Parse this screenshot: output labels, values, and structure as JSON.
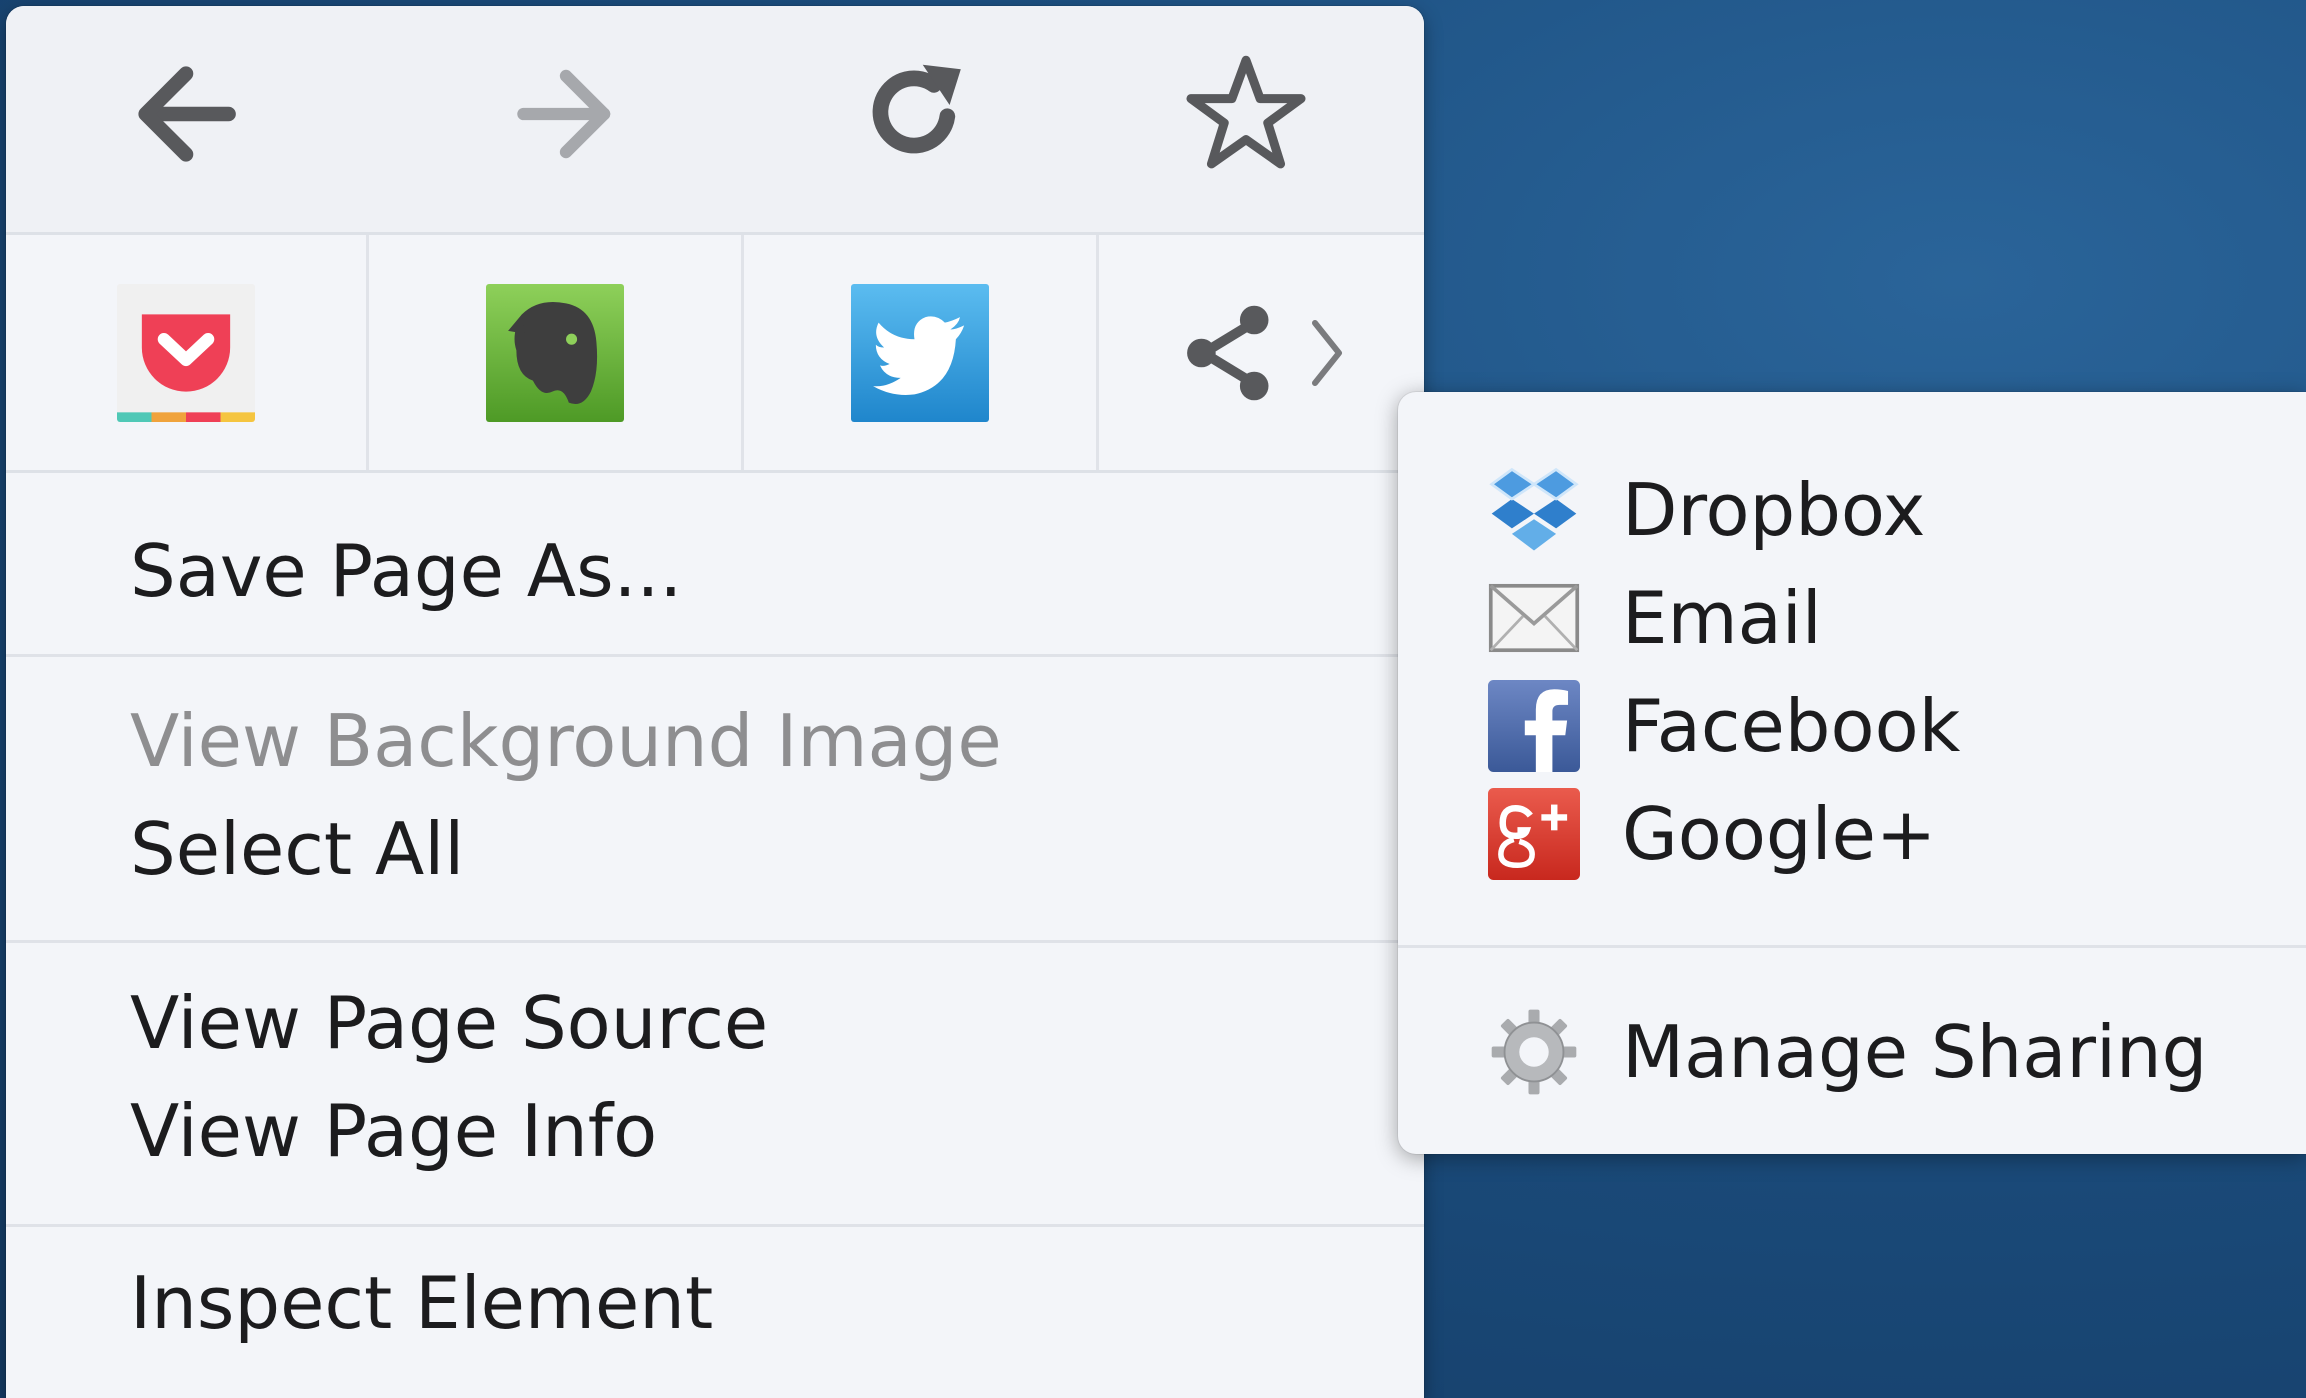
{
  "navigation": {
    "back_icon": "arrow-left-icon",
    "forward_icon": "arrow-right-icon",
    "reload_icon": "reload-icon",
    "bookmark_icon": "star-icon"
  },
  "share_toolbar": {
    "items": [
      {
        "name": "Pocket",
        "icon": "pocket-icon",
        "color": "#ef4056"
      },
      {
        "name": "Evernote",
        "icon": "evernote-icon",
        "color": "#6fb536"
      },
      {
        "name": "Twitter",
        "icon": "twitter-icon",
        "color": "#2f9be0"
      },
      {
        "name": "Share",
        "icon": "share-icon",
        "submenu_icon": "chevron-right-icon"
      }
    ]
  },
  "menu": {
    "save_page_as": "Save Page As...",
    "view_background_image": "View Background Image",
    "select_all": "Select All",
    "view_page_source": "View Page Source",
    "view_page_info": "View Page Info",
    "inspect_element": "Inspect Element"
  },
  "share_submenu": {
    "items": [
      {
        "label": "Dropbox",
        "icon": "dropbox-icon",
        "color": "#3f8fdb"
      },
      {
        "label": "Email",
        "icon": "email-icon"
      },
      {
        "label": "Facebook",
        "icon": "facebook-icon",
        "color": "#3b5998"
      },
      {
        "label": "Google+",
        "icon": "google-plus-icon",
        "color": "#d9372b"
      }
    ],
    "manage_sharing": "Manage Sharing",
    "manage_icon": "gear-icon"
  }
}
